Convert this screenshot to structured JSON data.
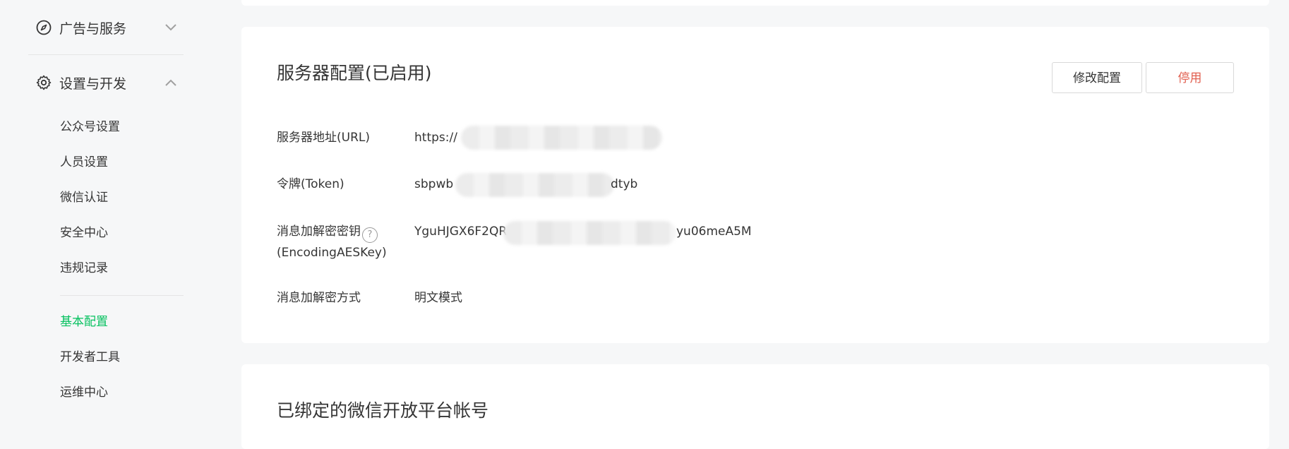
{
  "sidebar": {
    "group_ads": {
      "label": "广告与服务",
      "icon": "compass-icon"
    },
    "group_settings": {
      "label": "设置与开发",
      "icon": "gear-icon"
    },
    "items": [
      {
        "label": "公众号设置"
      },
      {
        "label": "人员设置"
      },
      {
        "label": "微信认证"
      },
      {
        "label": "安全中心"
      },
      {
        "label": "违规记录"
      }
    ],
    "items2": [
      {
        "label": "基本配置",
        "active": true
      },
      {
        "label": "开发者工具"
      },
      {
        "label": "运维中心"
      }
    ],
    "active_color": "#07c160"
  },
  "server_config": {
    "title": "服务器配置(已启用)",
    "modify_button": "修改配置",
    "disable_button": "停用",
    "url_label": "服务器地址(URL)",
    "url_value": "https://",
    "token_label": "令牌(Token)",
    "token_prefix": "sbpwb",
    "token_suffix": "dtyb",
    "aes_label_line1": "消息加解密密钥",
    "aes_label_line2": "(EncodingAESKey)",
    "aes_prefix": "YguHJGX6F2QR",
    "aes_suffix": "yu06meA5M",
    "encrypt_mode_label": "消息加解密方式",
    "encrypt_mode_value": "明文模式"
  },
  "bound_accounts": {
    "title": "已绑定的微信开放平台帐号"
  }
}
